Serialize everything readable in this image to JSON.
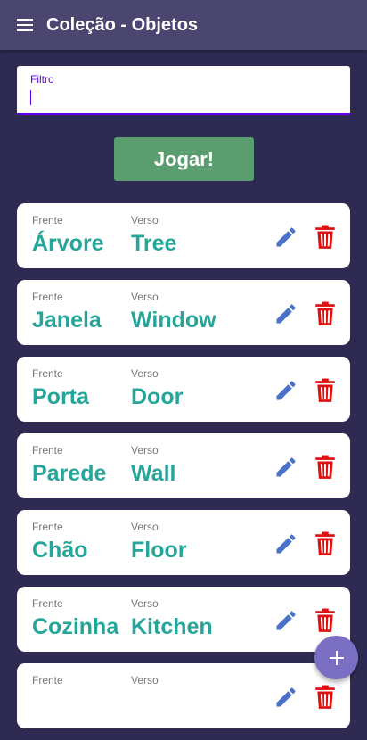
{
  "appbar": {
    "title": "Coleção - Objetos",
    "menu_icon": "hamburger-menu-icon"
  },
  "filter": {
    "label": "Filtro",
    "value": ""
  },
  "play_button": {
    "label": "Jogar!"
  },
  "cards": {
    "front_label": "Frente",
    "back_label": "Verso",
    "items": [
      {
        "front": "Árvore",
        "back": "Tree"
      },
      {
        "front": "Janela",
        "back": "Window"
      },
      {
        "front": "Porta",
        "back": "Door"
      },
      {
        "front": "Parede",
        "back": "Wall"
      },
      {
        "front": "Chão",
        "back": "Floor"
      },
      {
        "front": "Cozinha",
        "back": "Kitchen"
      },
      {
        "front": "",
        "back": ""
      }
    ]
  },
  "colors": {
    "background": "#2e2a52",
    "appbar": "#4a4670",
    "accent": "#6200ee",
    "play_button": "#5a9e6f",
    "card_text": "#26a69a",
    "edit_icon": "#4a72c9",
    "delete_icon": "#e01010",
    "fab": "#7b6fc4"
  },
  "fab": {
    "icon": "plus-icon"
  }
}
